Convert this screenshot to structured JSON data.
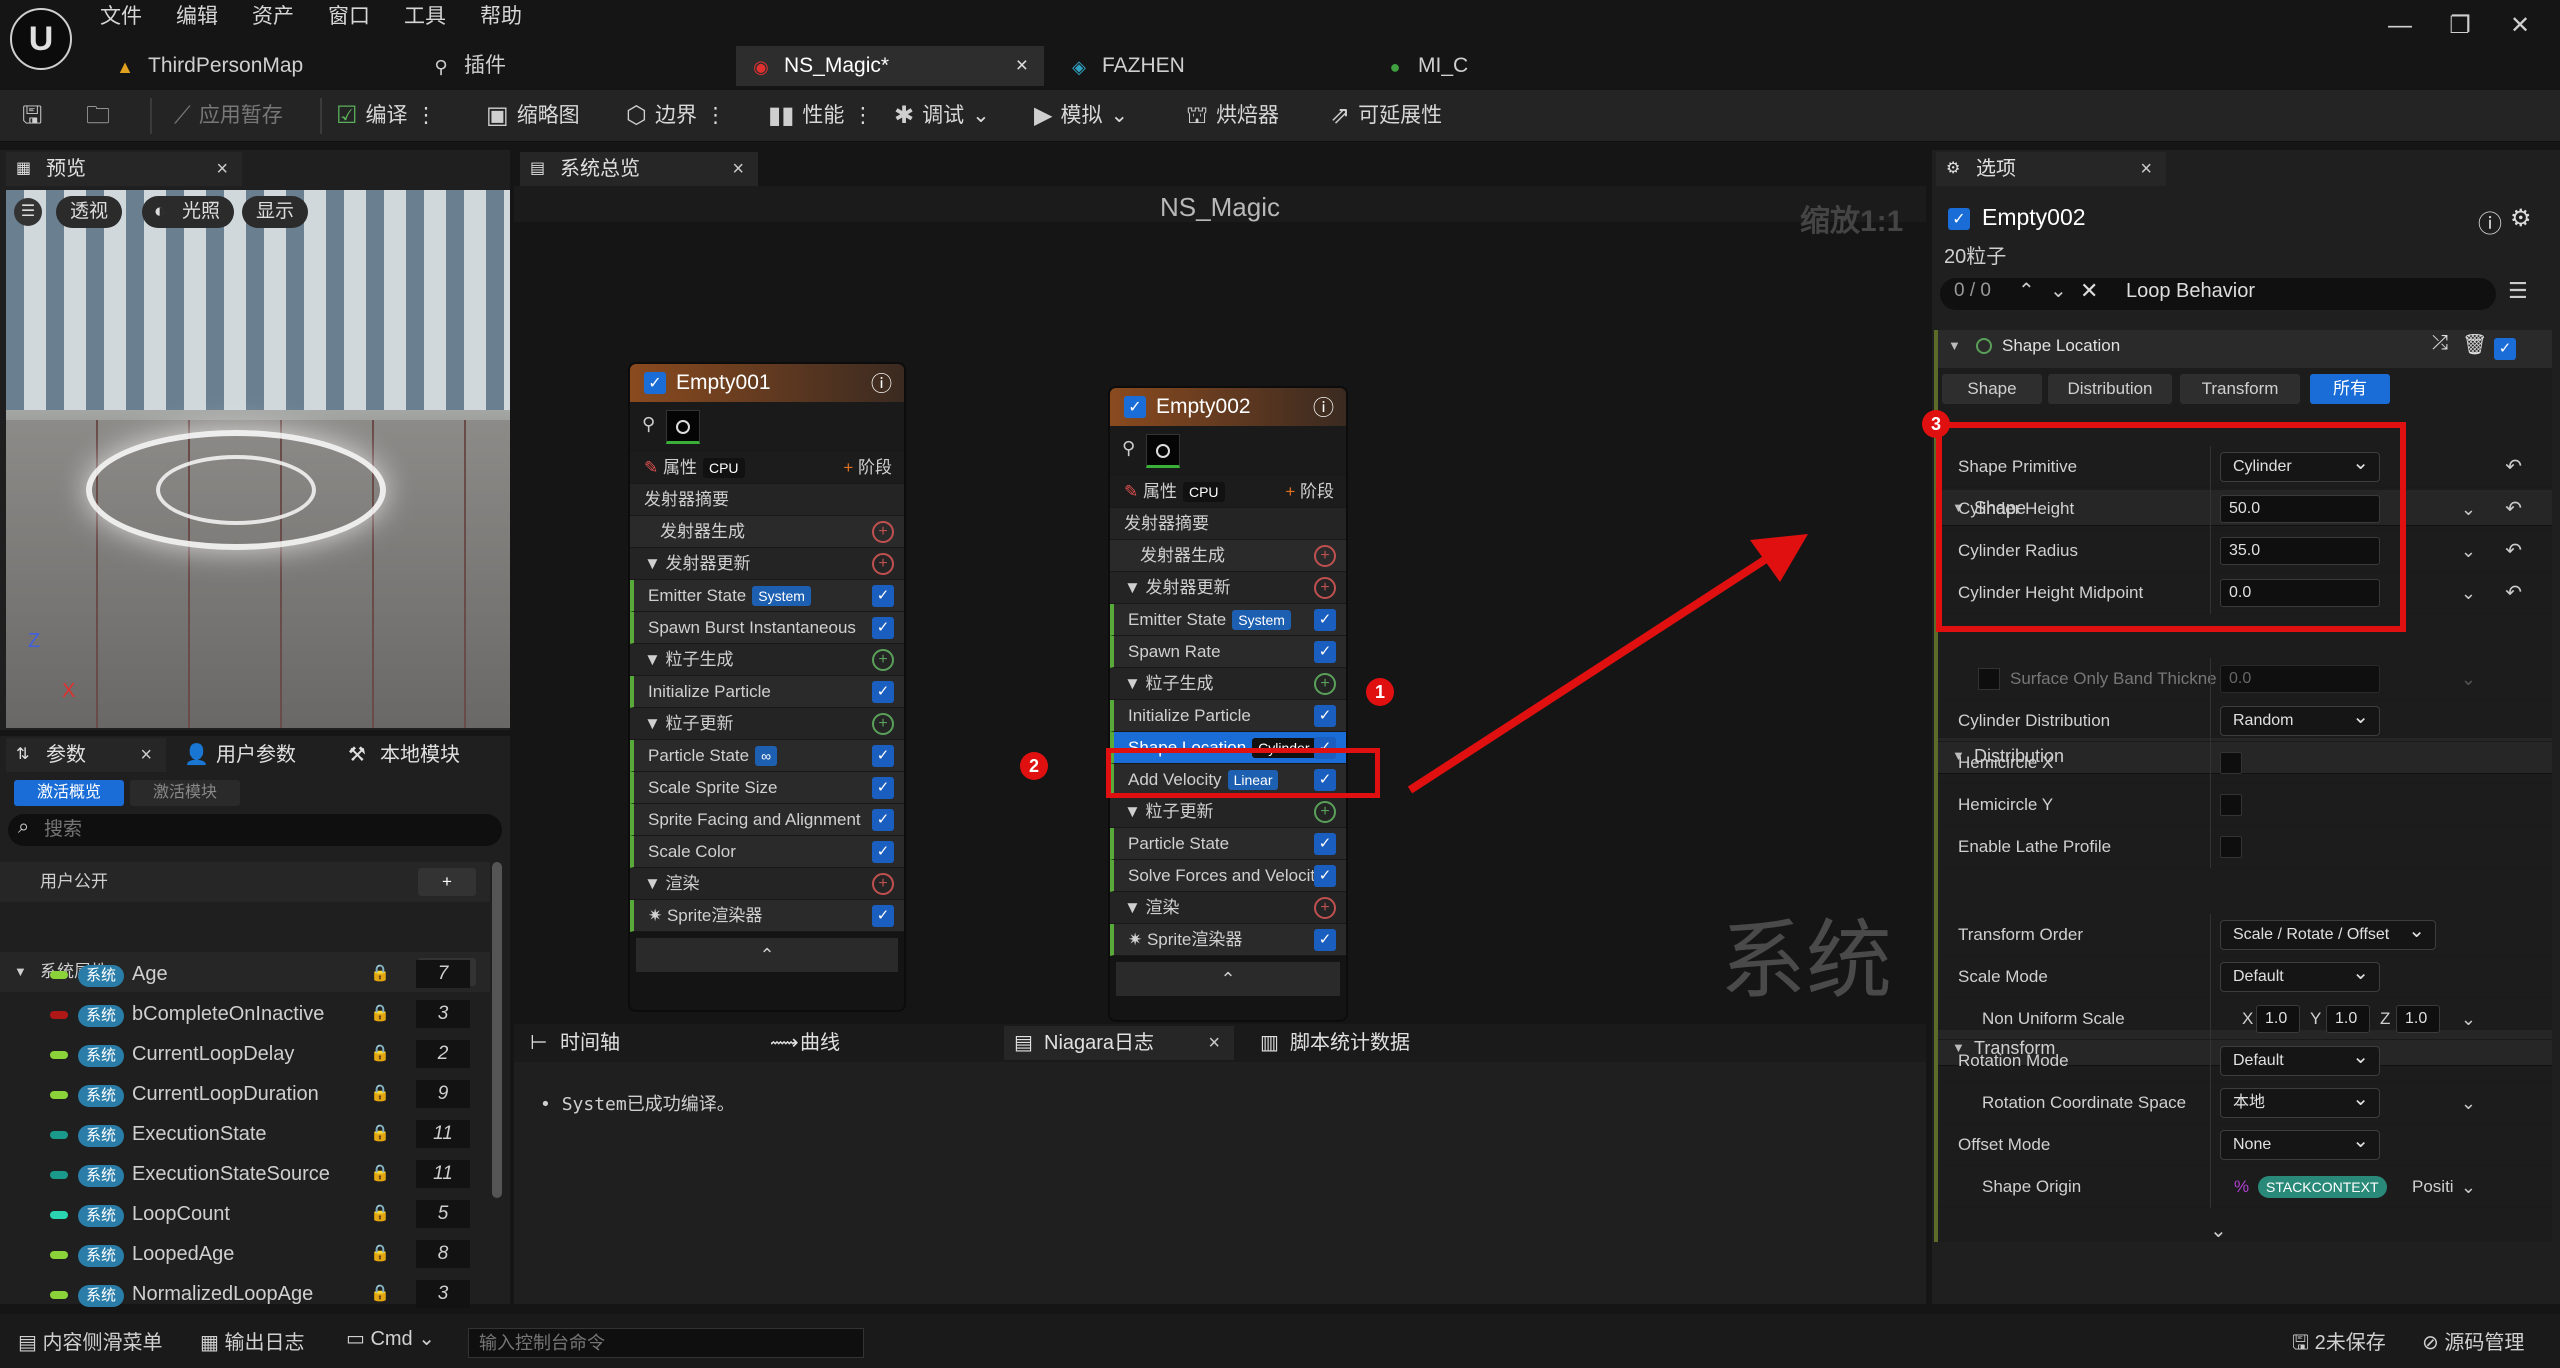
{
  "menu": [
    "文件",
    "编辑",
    "资产",
    "窗口",
    "工具",
    "帮助"
  ],
  "window_controls": {
    "min": "—",
    "max": "❐",
    "close": "✕"
  },
  "tabs": [
    {
      "label": "ThirdPersonMap",
      "icon": "map-icon"
    },
    {
      "label": "插件",
      "icon": "plug-icon"
    },
    {
      "label": "NS_Magic*",
      "icon": "niagara-icon"
    },
    {
      "label": "FAZHEN",
      "icon": "texture-icon"
    },
    {
      "label": "MI_C",
      "icon": "material-icon"
    }
  ],
  "tab_close": "×",
  "toolbar": {
    "apply": "应用暂存",
    "compile": "编译",
    "thumbnail": "缩略图",
    "bounds": "边界",
    "perf": "性能",
    "debug": "调试",
    "simulate": "模拟",
    "baker": "烘焙器",
    "scalability": "可延展性"
  },
  "preview": {
    "title": "预览",
    "perspective": "透视",
    "lighting": "光照",
    "show": "显示",
    "axis_z": "Z",
    "axis_x": "X"
  },
  "params": {
    "tabs": [
      "参数",
      "用户参数",
      "本地模块"
    ],
    "sub_active": "激活概览",
    "sub_inactive": "激活模块",
    "search_placeholder": "搜索",
    "user_public": "用户公开",
    "system_attrs": "系统属性",
    "badge": "系统",
    "items": [
      {
        "name": "Age",
        "num": "7",
        "color": "#8ad43a"
      },
      {
        "name": "bCompleteOnInactive",
        "num": "3",
        "color": "#b01818"
      },
      {
        "name": "CurrentLoopDelay",
        "num": "2",
        "color": "#8ad43a"
      },
      {
        "name": "CurrentLoopDuration",
        "num": "9",
        "color": "#8ad43a"
      },
      {
        "name": "ExecutionState",
        "num": "11",
        "color": "#1a9a8a"
      },
      {
        "name": "ExecutionStateSource",
        "num": "11",
        "color": "#1a9a8a"
      },
      {
        "name": "LoopCount",
        "num": "5",
        "color": "#2ad4b0"
      },
      {
        "name": "LoopedAge",
        "num": "8",
        "color": "#8ad43a"
      },
      {
        "name": "NormalizedLoopAge",
        "num": "3",
        "color": "#8ad43a"
      }
    ]
  },
  "graph": {
    "tab": "系统总览",
    "title": "NS_Magic",
    "zoom": "缩放1:1",
    "watermark": "系统",
    "emitter1": {
      "name": "Empty001",
      "props": "属性",
      "cpu": "CPU",
      "stage": "阶段",
      "rows": [
        {
          "t": "发射器摘要",
          "k": "sec"
        },
        {
          "t": "发射器生成",
          "k": "plusr"
        },
        {
          "t": "▼ 发射器更新",
          "k": "secplusr"
        },
        {
          "t": "Emitter State",
          "k": "chk",
          "pill": "System"
        },
        {
          "t": "Spawn Burst Instantaneous",
          "k": "chk"
        },
        {
          "t": "▼ 粒子生成",
          "k": "secplusg"
        },
        {
          "t": "Initialize Particle",
          "k": "chk"
        },
        {
          "t": "▼ 粒子更新",
          "k": "secplusg"
        },
        {
          "t": "Particle State",
          "k": "chk",
          "pill": "∞"
        },
        {
          "t": "Scale Sprite Size",
          "k": "chk"
        },
        {
          "t": "Sprite Facing and Alignment",
          "k": "chk"
        },
        {
          "t": "Scale Color",
          "k": "chk"
        },
        {
          "t": "▼ 渲染",
          "k": "secplusr"
        },
        {
          "t": "✷ Sprite渲染器",
          "k": "chk"
        }
      ]
    },
    "emitter2": {
      "name": "Empty002",
      "props": "属性",
      "cpu": "CPU",
      "stage": "阶段",
      "rows": [
        {
          "t": "发射器摘要",
          "k": "sec"
        },
        {
          "t": "发射器生成",
          "k": "plusr"
        },
        {
          "t": "▼ 发射器更新",
          "k": "secplusr"
        },
        {
          "t": "Emitter State",
          "k": "chk",
          "pill": "System"
        },
        {
          "t": "Spawn Rate",
          "k": "chk"
        },
        {
          "t": "▼ 粒子生成",
          "k": "secplusg"
        },
        {
          "t": "Initialize Particle",
          "k": "chk"
        },
        {
          "t": "Shape Location",
          "k": "sel",
          "pill": "Cylinder"
        },
        {
          "t": "Add Velocity",
          "k": "chk",
          "pill": "Linear"
        },
        {
          "t": "▼ 粒子更新",
          "k": "secplusg"
        },
        {
          "t": "Particle State",
          "k": "chk"
        },
        {
          "t": "Solve Forces and Velocity",
          "k": "chk"
        },
        {
          "t": "▼ 渲染",
          "k": "secplusr"
        },
        {
          "t": "✷ Sprite渲染器",
          "k": "chk"
        }
      ]
    },
    "badges": [
      "1",
      "2",
      "3"
    ]
  },
  "bottom": {
    "tabs": [
      "时间轴",
      "曲线",
      "Niagara日志",
      "脚本统计数据"
    ],
    "log": "System已成功编译。"
  },
  "details": {
    "tab": "选项",
    "emitter": "Empty002",
    "particles": "20粒子",
    "counter": "0 / 0",
    "search": "Loop Behavior",
    "module": "Shape Location",
    "filters": [
      "Shape",
      "Distribution",
      "Transform",
      "所有"
    ],
    "shape_section": "Shape",
    "shape_rows": [
      {
        "l": "Shape Primitive",
        "v": "Cylinder",
        "t": "dd"
      },
      {
        "l": "Cylinder Height",
        "v": "50.0",
        "t": "f"
      },
      {
        "l": "Cylinder Radius",
        "v": "35.0",
        "t": "f"
      },
      {
        "l": "Cylinder Height Midpoint",
        "v": "0.0",
        "t": "f"
      }
    ],
    "dist_section": "Distribution",
    "dist_rows": [
      {
        "l": "Surface Only Band Thickne",
        "v": "0.0",
        "t": "fd"
      },
      {
        "l": "Cylinder Distribution",
        "v": "Random",
        "t": "dd"
      },
      {
        "l": "Hemicircle X",
        "v": "",
        "t": "c"
      },
      {
        "l": "Hemicircle Y",
        "v": "",
        "t": "c"
      },
      {
        "l": "Enable Lathe Profile",
        "v": "",
        "t": "c"
      }
    ],
    "tr_section": "Transform",
    "tr_rows": [
      {
        "l": "Transform Order",
        "v": "Scale / Rotate / Offset",
        "t": "dd"
      },
      {
        "l": "Scale Mode",
        "v": "Default",
        "t": "dd"
      },
      {
        "l": "Non Uniform Scale",
        "v": "",
        "t": "xyz"
      },
      {
        "l": "Rotation Mode",
        "v": "Default",
        "t": "dd"
      },
      {
        "l": "Rotation Coordinate Space",
        "v": "本地",
        "t": "dd"
      },
      {
        "l": "Offset Mode",
        "v": "None",
        "t": "dd"
      },
      {
        "l": "Shape Origin",
        "v": "STACKCONTEXT",
        "t": "sc",
        "extra": "Positi"
      }
    ],
    "xyz": {
      "x": "X",
      "y": "Y",
      "z": "Z",
      "xv": "1.0",
      "yv": "1.0",
      "zv": "1.0"
    }
  },
  "status": {
    "drawer": "内容侧滑菜单",
    "output": "输出日志",
    "cmd": "Cmd",
    "console_placeholder": "输入控制台命令",
    "unsaved": "2未保存",
    "source": "源码管理"
  },
  "colors": {
    "accent": "#1a6dd6",
    "annotation": "#e01010",
    "emitter_header": "#8a4a1f"
  }
}
